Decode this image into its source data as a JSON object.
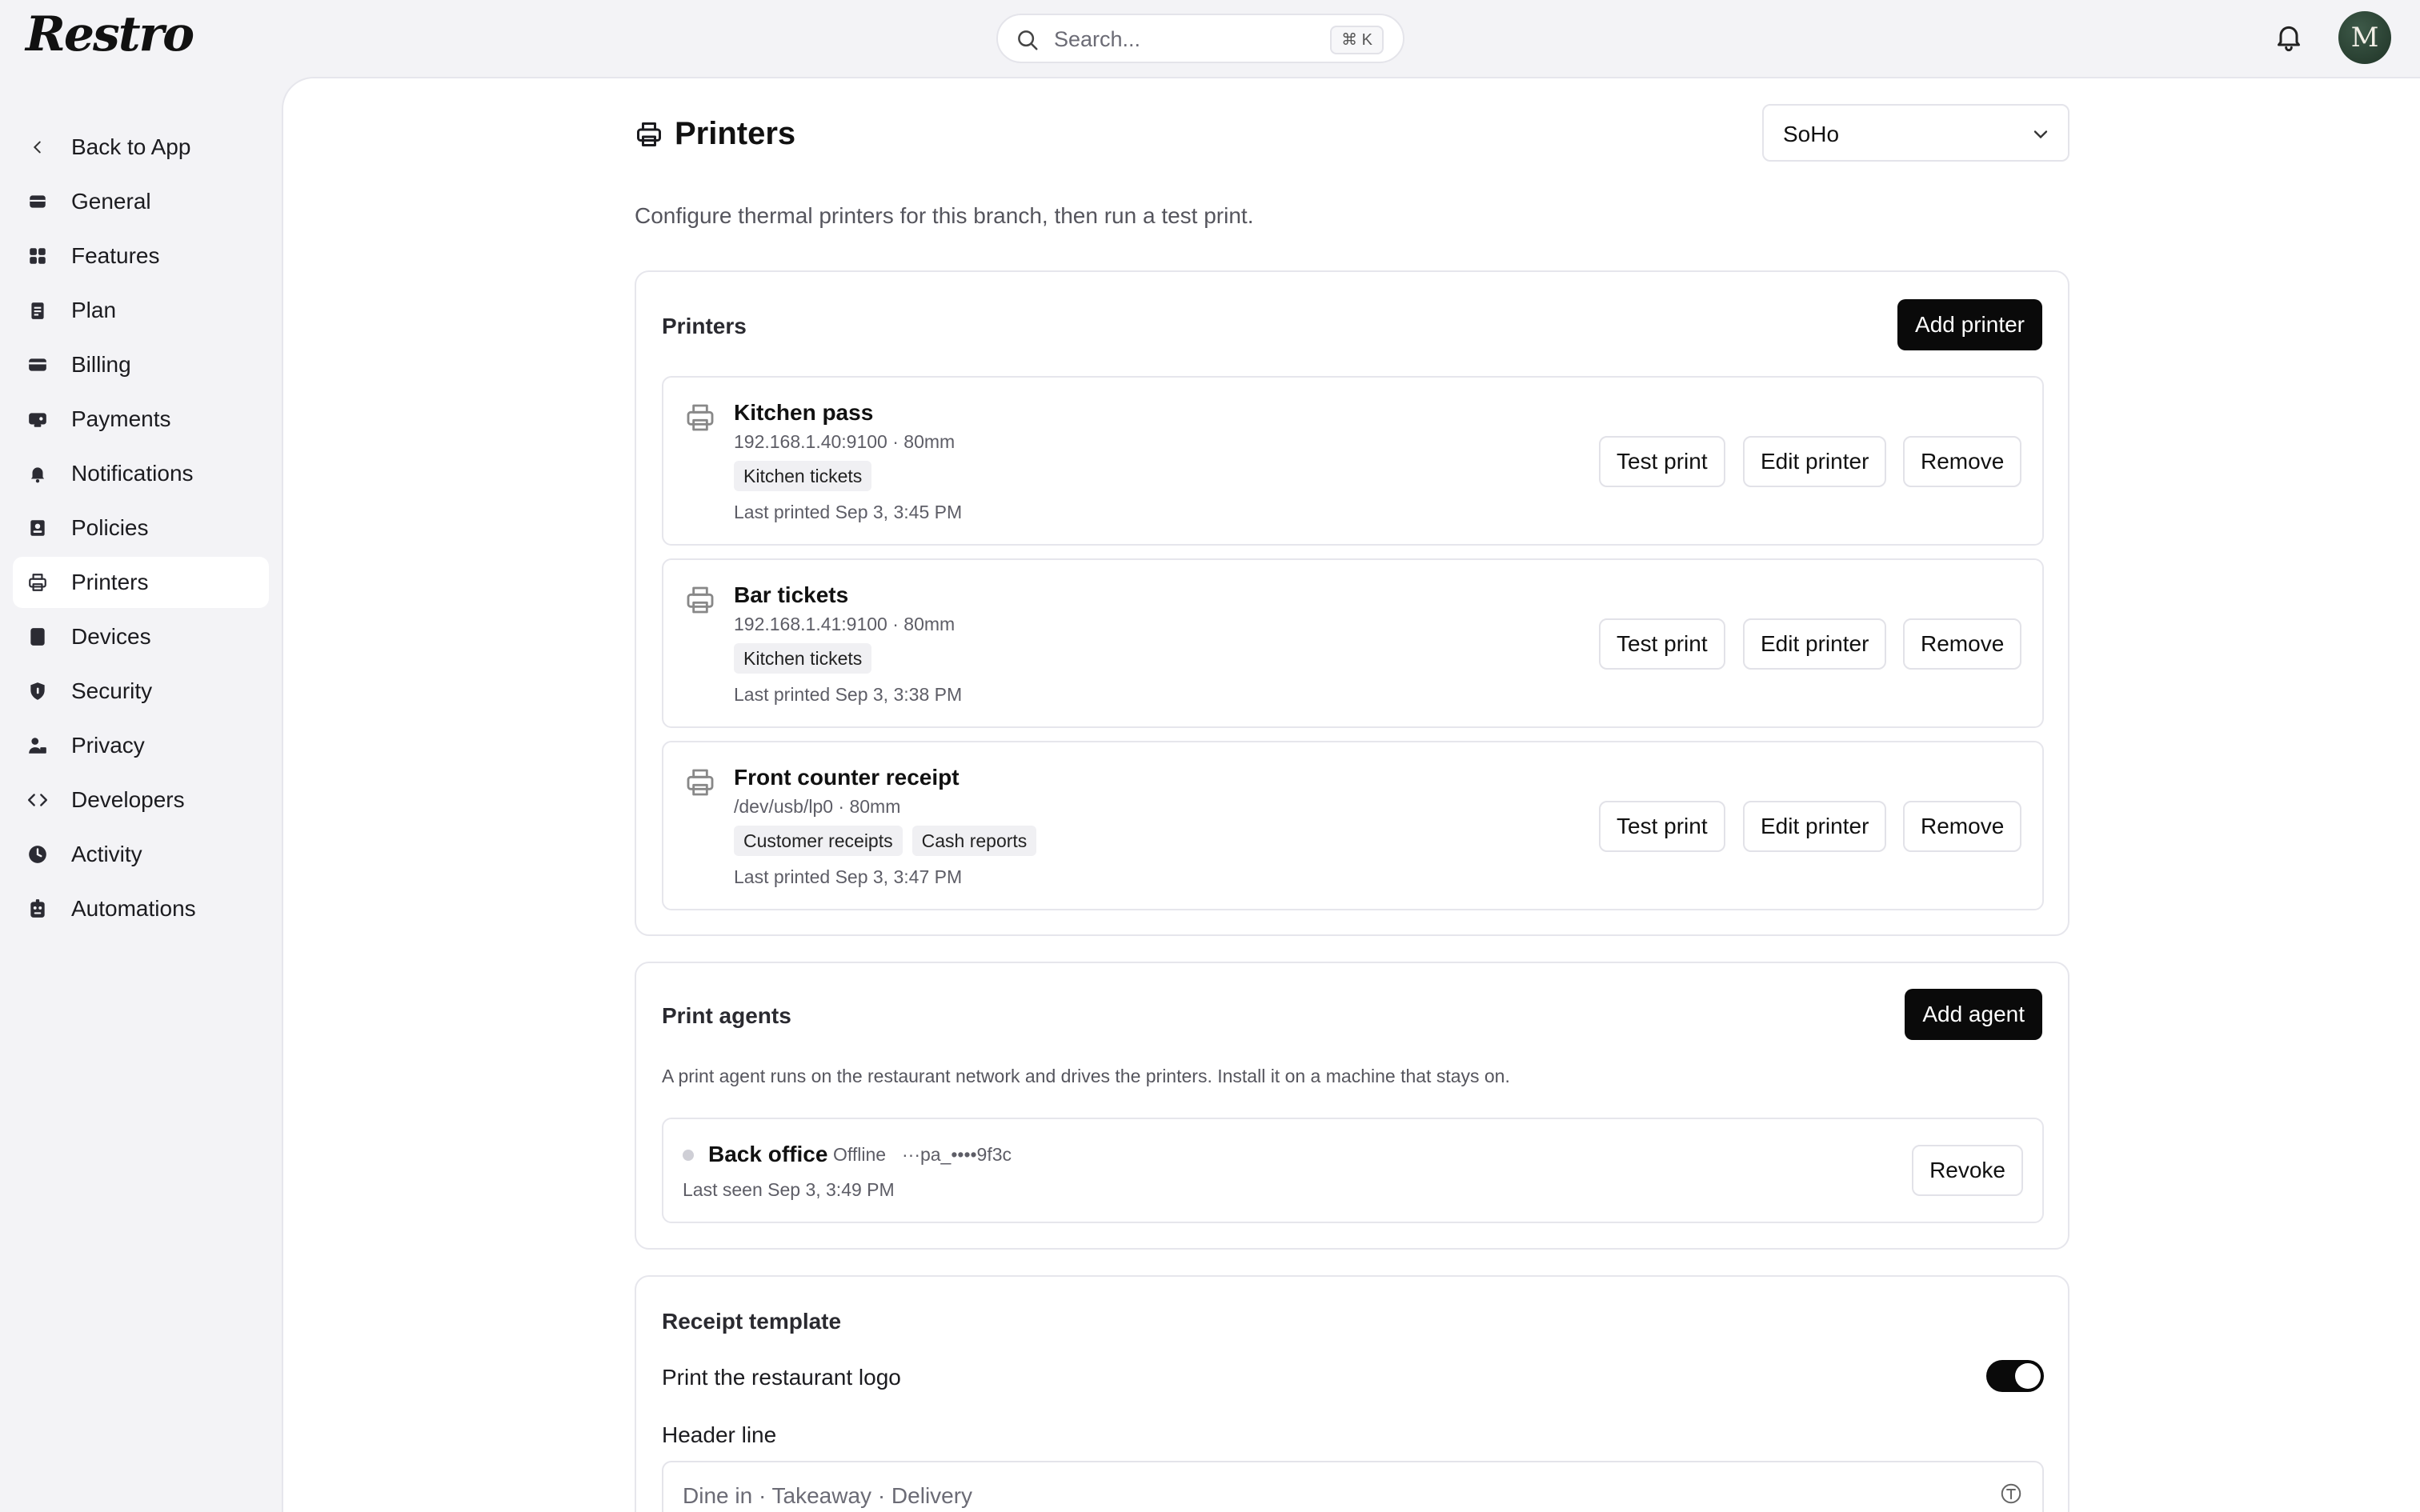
{
  "app": {
    "logo_text": "Restro"
  },
  "header": {
    "search_placeholder": "Search...",
    "search_shortcut": "⌘ K",
    "avatar_initial": "M"
  },
  "sidebar": {
    "back_label": "Back to App",
    "items": [
      {
        "label": "General",
        "icon": "card-icon"
      },
      {
        "label": "Features",
        "icon": "grid-icon"
      },
      {
        "label": "Plan",
        "icon": "clipboard-icon"
      },
      {
        "label": "Billing",
        "icon": "credit-card-icon"
      },
      {
        "label": "Payments",
        "icon": "wallet-icon"
      },
      {
        "label": "Notifications",
        "icon": "bell-icon"
      },
      {
        "label": "Policies",
        "icon": "policy-icon"
      },
      {
        "label": "Printers",
        "icon": "printer-icon",
        "active": true
      },
      {
        "label": "Devices",
        "icon": "tablet-icon"
      },
      {
        "label": "Security",
        "icon": "shield-icon"
      },
      {
        "label": "Privacy",
        "icon": "user-lock-icon"
      },
      {
        "label": "Developers",
        "icon": "code-icon"
      },
      {
        "label": "Activity",
        "icon": "clock-icon"
      },
      {
        "label": "Automations",
        "icon": "robot-icon"
      }
    ]
  },
  "page": {
    "title": "Printers",
    "branch": "SoHo",
    "subtitle": "Configure thermal printers for this branch, then run a test print."
  },
  "printers_card": {
    "title": "Printers",
    "add_label": "Add printer",
    "test_label": "Test print",
    "edit_label": "Edit printer",
    "remove_label": "Remove",
    "items": [
      {
        "name": "Kitchen pass",
        "meta": "192.168.1.40:9100 · 80mm",
        "tags": [
          "Kitchen tickets"
        ],
        "last": "Last printed Sep 3, 3:45 PM"
      },
      {
        "name": "Bar tickets",
        "meta": "192.168.1.41:9100 · 80mm",
        "tags": [
          "Kitchen tickets"
        ],
        "last": "Last printed Sep 3, 3:38 PM"
      },
      {
        "name": "Front counter receipt",
        "meta": "/dev/usb/lp0 · 80mm",
        "tags": [
          "Customer receipts",
          "Cash reports"
        ],
        "last": "Last printed Sep 3, 3:47 PM"
      }
    ]
  },
  "agents_card": {
    "title": "Print agents",
    "add_label": "Add agent",
    "description": "A print agent runs on the restaurant network and drives the printers. Install it on a machine that stays on.",
    "agent": {
      "name": "Back office",
      "status": "Offline",
      "token": "···pa_••••9f3c",
      "last_seen": "Last seen Sep 3, 3:49 PM",
      "revoke_label": "Revoke"
    }
  },
  "receipt_card": {
    "title": "Receipt template",
    "logo_toggle_label": "Print the restaurant logo",
    "logo_toggle_on": true,
    "header_line_label": "Header line",
    "header_line_placeholder": "Dine in · Takeaway · Delivery"
  },
  "colors": {
    "accent": "#0a0a0a",
    "sidebar_bg": "#f3f3f6",
    "active_item_bg": "#ffffff"
  }
}
